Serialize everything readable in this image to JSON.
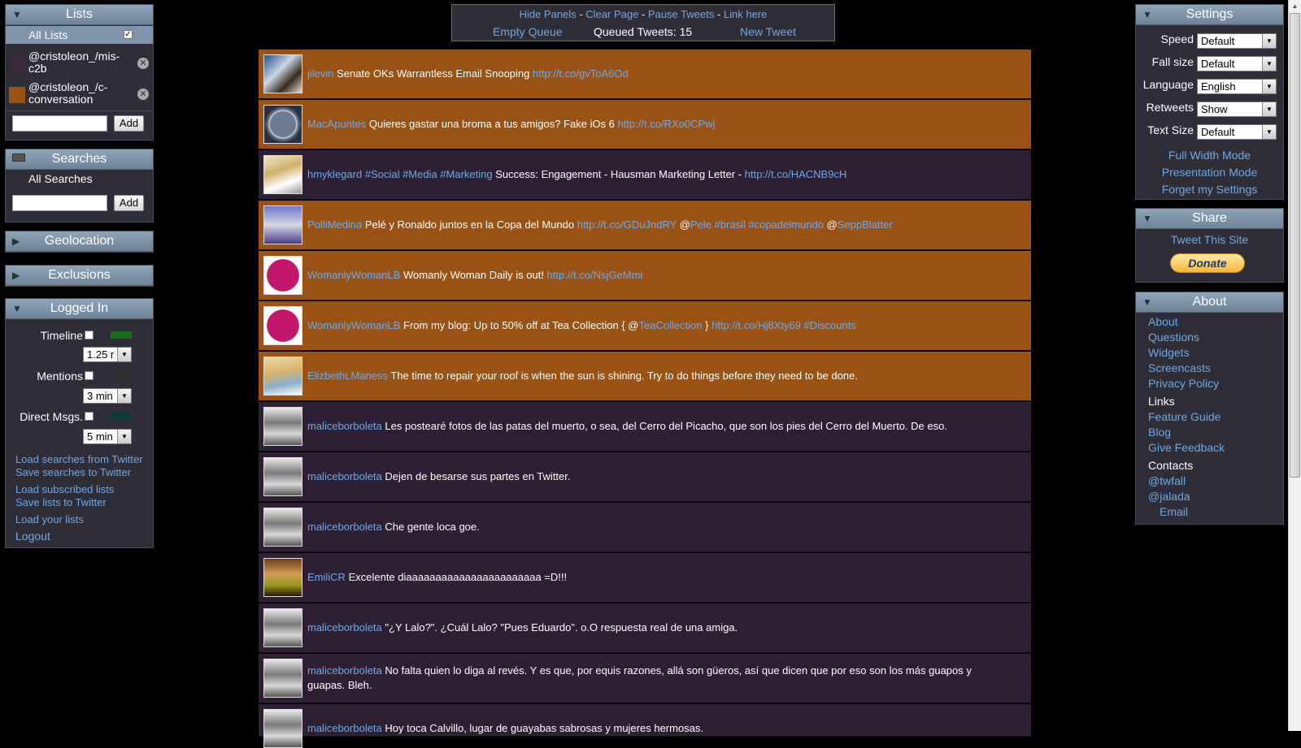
{
  "lists": {
    "title": "Lists",
    "all_label": "All Lists",
    "items": [
      {
        "name": "@cristoleon_/mis-\nc2b",
        "color": "#3a2a3a"
      },
      {
        "name": "@cristoleon_/c-\nconversation",
        "color": "#9a5215"
      }
    ],
    "add_label": "Add"
  },
  "searches": {
    "title": "Searches",
    "all_label": "All Searches",
    "add_label": "Add"
  },
  "geolocation": {
    "title": "Geolocation"
  },
  "exclusions": {
    "title": "Exclusions"
  },
  "logged_in": {
    "title": "Logged In",
    "timeline_label": "Timeline",
    "timeline_interval": "1.25 r",
    "timeline_color": "#1c6b1c",
    "mentions_label": "Mentions",
    "mentions_interval": "3 min",
    "mentions_color": "#2e2e2e",
    "dm_label": "Direct Msgs.",
    "dm_interval": "5 min",
    "dm_color": "#0e3b33",
    "links": [
      "Load searches from Twitter",
      "Save searches to Twitter",
      "Load subscribed lists",
      "Save lists to Twitter",
      "Load your lists"
    ],
    "logout": "Logout"
  },
  "topbar": {
    "hide_panels": "Hide Panels",
    "clear_page": "Clear Page",
    "pause_tweets": "Pause Tweets",
    "link_here": "Link here",
    "sep": "-",
    "empty_queue": "Empty Queue",
    "queued_tweets": "Queued Tweets: 15",
    "new_tweet": "New Tweet"
  },
  "tweets": [
    {
      "user": "jilevin",
      "parts": [
        {
          "t": "text",
          "v": " Senate OKs Warrantless Email Snooping "
        },
        {
          "t": "link",
          "v": "http://t.co/gvToA6Od"
        }
      ],
      "style": "o",
      "avatar": "a1"
    },
    {
      "user": "MacApuntes",
      "parts": [
        {
          "t": "text",
          "v": " Quieres gastar una broma a tus amigos? Fake iOs 6 "
        },
        {
          "t": "link",
          "v": "http://t.co/RXo0CPwj"
        }
      ],
      "style": "o",
      "avatar": "a2"
    },
    {
      "user": "hmyklegard",
      "parts": [
        {
          "t": "link",
          "v": " #Social #Media #Marketing"
        },
        {
          "t": "text",
          "v": " Success: Engagement - Hausman Marketing Letter - "
        },
        {
          "t": "link",
          "v": "http://t.co/HACNB9cH"
        }
      ],
      "style": "p",
      "avatar": "a3"
    },
    {
      "user": "PolliMedina",
      "parts": [
        {
          "t": "text",
          "v": " Pelé y Ronaldo juntos en la Copa del Mundo "
        },
        {
          "t": "link",
          "v": "http://t.co/GDuJndRY"
        },
        {
          "t": "text",
          "v": " @"
        },
        {
          "t": "link",
          "v": "Pele #brasil #copadelmundo"
        },
        {
          "t": "text",
          "v": " @"
        },
        {
          "t": "link",
          "v": "SeppBlatter"
        }
      ],
      "style": "o",
      "avatar": "a4"
    },
    {
      "user": "WomanlyWomanLB",
      "parts": [
        {
          "t": "text",
          "v": " Womanly Woman Daily is out! "
        },
        {
          "t": "link",
          "v": "http://t.co/NsjGeMmi"
        }
      ],
      "style": "o",
      "avatar": "a5"
    },
    {
      "user": "WomanlyWomanLB",
      "parts": [
        {
          "t": "text",
          "v": " From my blog: Up to 50% off at Tea Collection { @"
        },
        {
          "t": "link",
          "v": "TeaCollection"
        },
        {
          "t": "text",
          "v": " } "
        },
        {
          "t": "link",
          "v": "http://t.co/Hj8Xty69 #Discounts"
        }
      ],
      "style": "o",
      "avatar": "a5"
    },
    {
      "user": "ElizbethLManess",
      "parts": [
        {
          "t": "text",
          "v": " The time to repair your roof is when the sun is shining. Try to do things before they need to be done."
        }
      ],
      "style": "o",
      "avatar": "a6"
    },
    {
      "user": "maliceborboleta",
      "parts": [
        {
          "t": "text",
          "v": " Les postearé fotos de las patas del muerto, o sea, del Cerro del Picacho, que son los pies del Cerro del Muerto. De eso."
        }
      ],
      "style": "p",
      "avatar": "a7"
    },
    {
      "user": "maliceborboleta",
      "parts": [
        {
          "t": "text",
          "v": " Dejen de besarse sus partes en Twitter."
        }
      ],
      "style": "p",
      "avatar": "a7"
    },
    {
      "user": "maliceborboleta",
      "parts": [
        {
          "t": "text",
          "v": " Che gente loca goe."
        }
      ],
      "style": "p",
      "avatar": "a7"
    },
    {
      "user": "EmiliCR",
      "parts": [
        {
          "t": "text",
          "v": " Excelente diaaaaaaaaaaaaaaaaaaaaaaa =D!!!"
        }
      ],
      "style": "p",
      "avatar": "a8"
    },
    {
      "user": "maliceborboleta",
      "parts": [
        {
          "t": "text",
          "v": " \"¿Y Lalo?\". ¿Cuál Lalo? \"Pues Eduardo\". o.O respuesta real de una amiga."
        }
      ],
      "style": "p",
      "avatar": "a7"
    },
    {
      "user": "maliceborboleta",
      "parts": [
        {
          "t": "text",
          "v": " No falta quien lo diga al revés. Y es que, por equis razones, allá son güeros, así que dicen que por eso son los más guapos y guapas. Bleh."
        }
      ],
      "style": "p",
      "avatar": "a7"
    },
    {
      "user": "maliceborboleta",
      "parts": [
        {
          "t": "text",
          "v": " Hoy toca Calvillo, lugar de guayabas sabrosas y mujeres hermosas."
        }
      ],
      "style": "p",
      "avatar": "a7"
    }
  ],
  "settings": {
    "title": "Settings",
    "rows": [
      {
        "label": "Speed",
        "value": "Default"
      },
      {
        "label": "Fall size",
        "value": "Default"
      },
      {
        "label": "Language",
        "value": "English"
      },
      {
        "label": "Retweets",
        "value": "Show"
      },
      {
        "label": "Text Size",
        "value": "Default"
      }
    ],
    "links": [
      "Full Width Mode",
      "Presentation Mode",
      "Forget my Settings"
    ]
  },
  "share": {
    "title": "Share",
    "tweet_site": "Tweet This Site",
    "donate": "Donate"
  },
  "about": {
    "title": "About",
    "links": [
      "About",
      "Questions",
      "Widgets",
      "Screencasts",
      "Privacy Policy"
    ],
    "links_heading": "Links",
    "links2": [
      "Feature Guide",
      "Blog",
      "Give Feedback"
    ],
    "contacts_heading": "Contacts",
    "contacts": [
      "@twfall",
      "@jalada"
    ],
    "email": "Email"
  },
  "colors": {
    "orange_row": "#9a5215",
    "purple_row": "#2f1f35",
    "link": "#6fa8e6",
    "panel_header": "#7f94aa"
  }
}
